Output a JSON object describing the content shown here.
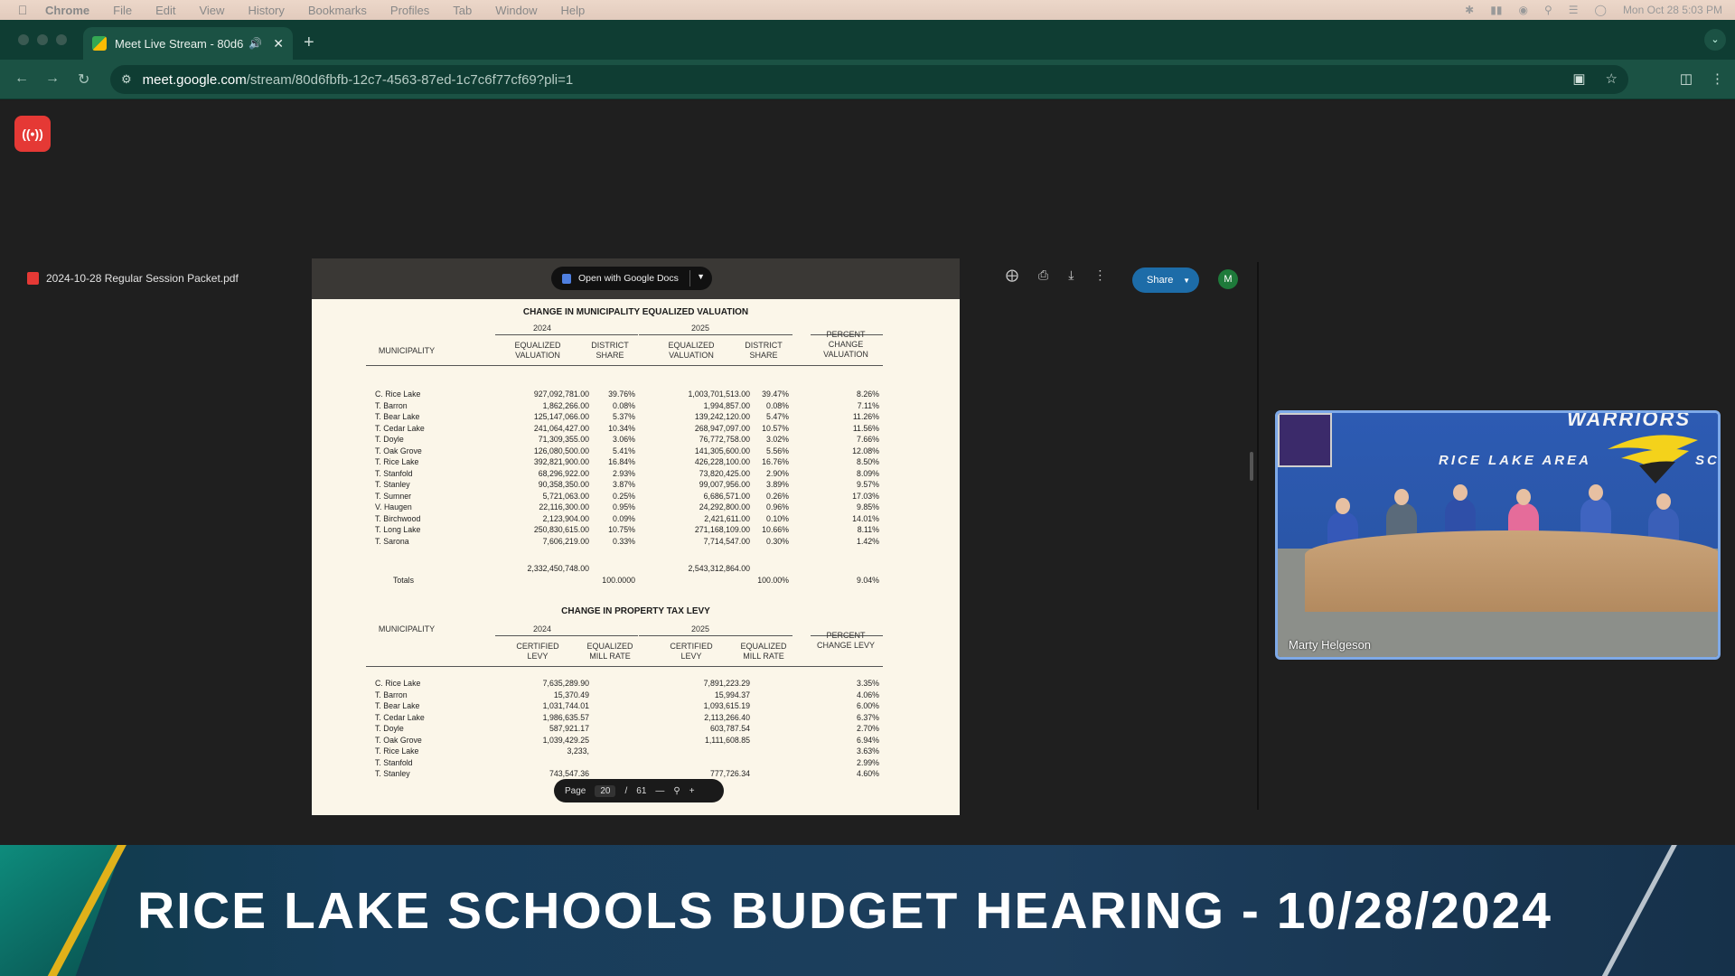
{
  "menubar": {
    "items": [
      "Chrome",
      "File",
      "Edit",
      "View",
      "History",
      "Bookmarks",
      "Profiles",
      "Tab",
      "Window",
      "Help"
    ],
    "clock": "Mon Oct 28 5:03 PM"
  },
  "browser": {
    "tab_title": "Meet Live Stream - 80d6",
    "url_domain": "meet.google.com",
    "url_path": "/stream/80d6fbfb-12c7-4563-87ed-1c7c6f77cf69?pli=1"
  },
  "document": {
    "filename": "2024-10-28 Regular Session Packet.pdf",
    "open_with_label": "Open with Google Docs",
    "share_label": "Share",
    "avatar_initial": "M",
    "page_label": "Page",
    "page_current": "20",
    "page_sep": "/",
    "page_total": "61"
  },
  "table1": {
    "title": "CHANGE IN MUNICIPALITY EQUALIZED VALUATION",
    "year_a": "2024",
    "year_b": "2025",
    "col_municipality": "MUNICIPALITY",
    "col_eq_val_a": "EQUALIZED VALUATION",
    "col_district_a": "DISTRICT SHARE",
    "col_eq_val_b": "EQUALIZED VALUATION",
    "col_district_b": "DISTRICT SHARE",
    "col_percent": "PERCENT CHANGE VALUATION",
    "rows": [
      [
        "C. Rice Lake",
        "927,092,781.00",
        "39.76%",
        "1,003,701,513.00",
        "39.47%",
        "8.26%"
      ],
      [
        "T. Barron",
        "1,862,266.00",
        "0.08%",
        "1,994,857.00",
        "0.08%",
        "7.11%"
      ],
      [
        "T. Bear Lake",
        "125,147,066.00",
        "5.37%",
        "139,242,120.00",
        "5.47%",
        "11.26%"
      ],
      [
        "T. Cedar Lake",
        "241,064,427.00",
        "10.34%",
        "268,947,097.00",
        "10.57%",
        "11.56%"
      ],
      [
        "T. Doyle",
        "71,309,355.00",
        "3.06%",
        "76,772,758.00",
        "3.02%",
        "7.66%"
      ],
      [
        "T. Oak Grove",
        "126,080,500.00",
        "5.41%",
        "141,305,600.00",
        "5.56%",
        "12.08%"
      ],
      [
        "T. Rice Lake",
        "392,821,900.00",
        "16.84%",
        "426,228,100.00",
        "16.76%",
        "8.50%"
      ],
      [
        "T. Stanfold",
        "68,296,922.00",
        "2.93%",
        "73,820,425.00",
        "2.90%",
        "8.09%"
      ],
      [
        "T. Stanley",
        "90,358,350.00",
        "3.87%",
        "99,007,956.00",
        "3.89%",
        "9.57%"
      ],
      [
        "T. Sumner",
        "5,721,063.00",
        "0.25%",
        "6,686,571.00",
        "0.26%",
        "17.03%"
      ],
      [
        "V. Haugen",
        "22,116,300.00",
        "0.95%",
        "24,292,800.00",
        "0.96%",
        "9.85%"
      ],
      [
        "T. Birchwood",
        "2,123,904.00",
        "0.09%",
        "2,421,611.00",
        "0.10%",
        "14.01%"
      ],
      [
        "T. Long Lake",
        "250,830,615.00",
        "10.75%",
        "271,168,109.00",
        "10.66%",
        "8.11%"
      ],
      [
        "T. Sarona",
        "7,606,219.00",
        "0.33%",
        "7,714,547.00",
        "0.30%",
        "1.42%"
      ]
    ],
    "totals_label": "Totals",
    "total_a": "2,332,450,748.00",
    "total_share_a": "100.0000",
    "total_b": "2,543,312,864.00",
    "total_share_b": "100.00%",
    "total_percent": "9.04%"
  },
  "table2": {
    "title": "CHANGE IN PROPERTY TAX LEVY",
    "year_a": "2024",
    "year_b": "2025",
    "col_municipality": "MUNICIPALITY",
    "col_cert_a": "CERTIFIED LEVY",
    "col_mill_a": "EQUALIZED MILL RATE",
    "col_cert_b": "CERTIFIED LEVY",
    "col_mill_b": "EQUALIZED MILL RATE",
    "col_percent": "PERCENT CHANGE LEVY",
    "rows": [
      [
        "C. Rice Lake",
        "7,635,289.90",
        "7,891,223.29",
        "3.35%"
      ],
      [
        "T. Barron",
        "15,370.49",
        "15,994.37",
        "4.06%"
      ],
      [
        "T. Bear Lake",
        "1,031,744.01",
        "1,093,615.19",
        "6.00%"
      ],
      [
        "T. Cedar Lake",
        "1,986,635.57",
        "2,113,266.40",
        "6.37%"
      ],
      [
        "T. Doyle",
        "587,921.17",
        "603,787.54",
        "2.70%"
      ],
      [
        "T. Oak Grove",
        "1,039,429.25",
        "1,111,608.85",
        "6.94%"
      ],
      [
        "T. Rice Lake",
        "3,233,",
        "",
        "3.63%"
      ],
      [
        "T. Stanfold",
        "",
        "",
        "2.99%"
      ],
      [
        "T. Stanley",
        "743,547.36",
        "777,726.34",
        "4.60%"
      ]
    ]
  },
  "video": {
    "participant_name": "Marty Helgeson",
    "wall_text": "RICE LAKE AREA",
    "wall_top_text": "WARRIORS",
    "wall_edge_text": "SC"
  },
  "banner": {
    "title": "RICE LAKE SCHOOLS BUDGET HEARING - 10/28/2024"
  },
  "colors": {
    "chrome_frame": "#0f3d33",
    "chrome_toolbar": "#1b5244",
    "live_badge": "#e53935",
    "share_button": "#1d6ca8",
    "banner_gold": "#e0b11a"
  }
}
